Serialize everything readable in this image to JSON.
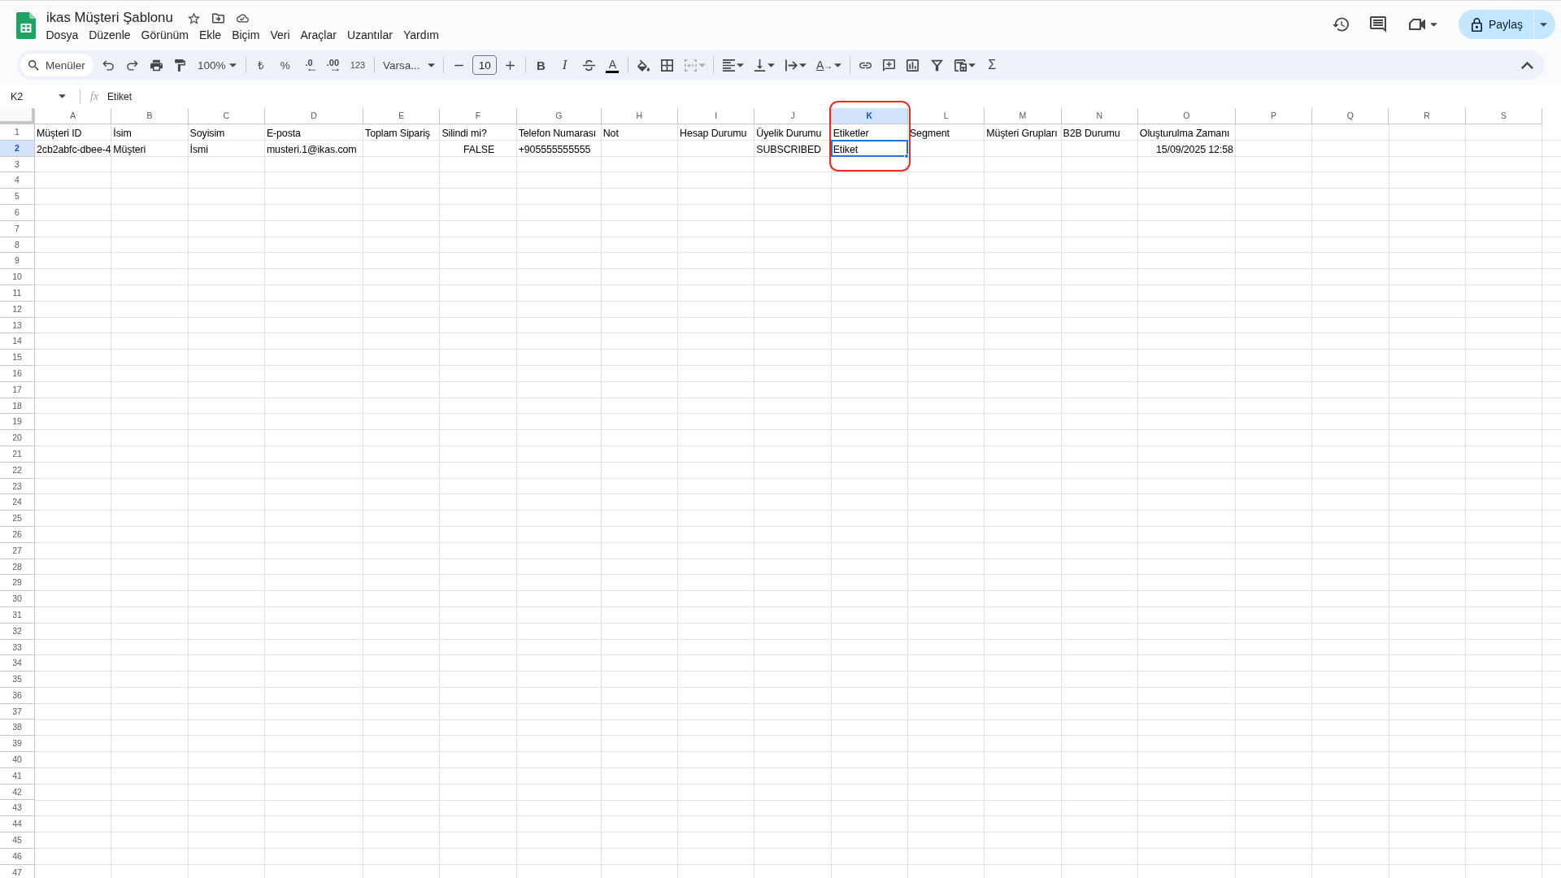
{
  "document": {
    "title": "ikas Müşteri Şablonu"
  },
  "menu": [
    "Dosya",
    "Düzenle",
    "Görünüm",
    "Ekle",
    "Biçim",
    "Veri",
    "Araçlar",
    "Uzantılar",
    "Yardım"
  ],
  "share_button": {
    "label": "Paylaş"
  },
  "toolbar": {
    "search": {
      "placeholder": "Menüler"
    },
    "zoom": "100%",
    "currency": "₺",
    "percent": "%",
    "decrease_decimals": ".0",
    "increase_decimals": ".00",
    "number_format": "123",
    "font": "Varsa...",
    "font_size": "10",
    "bold": "B",
    "italic": "I",
    "text_color": "A",
    "text_rotation": "A",
    "functions": "Σ",
    "merge_cells": {
      "disabled": true
    }
  },
  "formula_bar": {
    "cell": "K2",
    "label": "fx",
    "value": "Etiket"
  },
  "sheet": {
    "columns": [
      {
        "letter": "A",
        "selected": false,
        "highlighted": false
      },
      {
        "letter": "B",
        "selected": false,
        "highlighted": false
      },
      {
        "letter": "C",
        "selected": false,
        "highlighted": false
      },
      {
        "letter": "D",
        "selected": false,
        "highlighted": false
      },
      {
        "letter": "E",
        "selected": false,
        "highlighted": false
      },
      {
        "letter": "F",
        "selected": false,
        "highlighted": false
      },
      {
        "letter": "G",
        "selected": false,
        "highlighted": false
      },
      {
        "letter": "H",
        "selected": false,
        "highlighted": false
      },
      {
        "letter": "I",
        "selected": false,
        "highlighted": false
      },
      {
        "letter": "J",
        "selected": false,
        "highlighted": false
      },
      {
        "letter": "K",
        "selected": true,
        "highlighted": true
      },
      {
        "letter": "L",
        "selected": false,
        "highlighted": false
      },
      {
        "letter": "M",
        "selected": false,
        "highlighted": false
      },
      {
        "letter": "N",
        "selected": false,
        "highlighted": false
      },
      {
        "letter": "O",
        "selected": false,
        "highlighted": false
      },
      {
        "letter": "P",
        "selected": false,
        "highlighted": false
      },
      {
        "letter": "Q",
        "selected": false,
        "highlighted": false
      },
      {
        "letter": "R",
        "selected": false,
        "highlighted": false
      },
      {
        "letter": "S",
        "selected": false,
        "highlighted": false
      }
    ],
    "rows": [
      {
        "number": "1",
        "selected": false,
        "cells": [
          {
            "kind": "text",
            "value": "Müşteri ID"
          },
          {
            "kind": "text",
            "value": "İsim"
          },
          {
            "kind": "text",
            "value": "Soyisim"
          },
          {
            "kind": "text",
            "value": "E-posta"
          },
          {
            "kind": "text",
            "value": "Toplam Sipariş"
          },
          {
            "kind": "text",
            "value": "Silindi mi?"
          },
          {
            "kind": "text",
            "value": "Telefon Numarası"
          },
          {
            "kind": "text",
            "value": "Not"
          },
          {
            "kind": "text",
            "value": "Hesap Durumu"
          },
          {
            "kind": "text",
            "value": "Üyelik Durumu"
          },
          {
            "kind": "text",
            "value": "Etiketler"
          },
          {
            "kind": "text",
            "value": "Segment"
          },
          {
            "kind": "text",
            "value": "Müşteri Grupları"
          },
          {
            "kind": "text",
            "value": "B2B Durumu"
          },
          {
            "kind": "text",
            "value": "Oluşturulma Zamanı"
          }
        ]
      },
      {
        "number": "2",
        "selected": true,
        "cells": [
          {
            "kind": "text",
            "value": "2cb2abfc-dbee-4"
          },
          {
            "kind": "text",
            "value": "Müşteri"
          },
          {
            "kind": "text",
            "value": "İsmi"
          },
          {
            "kind": "text",
            "value": "musteri.1@ikas.com"
          },
          {
            "kind": "blank"
          },
          {
            "kind": "boolean",
            "value": "FALSE"
          },
          {
            "kind": "text",
            "value": "+905555555555"
          },
          {
            "kind": "blank"
          },
          {
            "kind": "blank"
          },
          {
            "kind": "text",
            "value": "SUBSCRIBED"
          },
          {
            "kind": "text",
            "value": "Etiket"
          },
          {
            "kind": "blank"
          },
          {
            "kind": "blank"
          },
          {
            "kind": "blank"
          },
          {
            "kind": "date",
            "value": "15/09/2025 12:58"
          }
        ]
      },
      {
        "number": "3",
        "selected": false
      },
      {
        "number": "4",
        "selected": false
      },
      {
        "number": "5",
        "selected": false
      },
      {
        "number": "6",
        "selected": false
      },
      {
        "number": "7",
        "selected": false
      },
      {
        "number": "8",
        "selected": false
      },
      {
        "number": "9",
        "selected": false
      },
      {
        "number": "10",
        "selected": false
      },
      {
        "number": "11",
        "selected": false
      },
      {
        "number": "12",
        "selected": false
      },
      {
        "number": "13",
        "selected": false
      },
      {
        "number": "14",
        "selected": false
      },
      {
        "number": "15",
        "selected": false
      },
      {
        "number": "16",
        "selected": false
      },
      {
        "number": "17",
        "selected": false
      },
      {
        "number": "18",
        "selected": false
      },
      {
        "number": "19",
        "selected": false
      },
      {
        "number": "20",
        "selected": false
      },
      {
        "number": "21",
        "selected": false
      },
      {
        "number": "22",
        "selected": false
      },
      {
        "number": "23",
        "selected": false
      },
      {
        "number": "24",
        "selected": false
      },
      {
        "number": "25",
        "selected": false
      },
      {
        "number": "26",
        "selected": false
      },
      {
        "number": "27",
        "selected": false
      },
      {
        "number": "28",
        "selected": false
      },
      {
        "number": "29",
        "selected": false
      },
      {
        "number": "30",
        "selected": false
      },
      {
        "number": "31",
        "selected": false
      },
      {
        "number": "32",
        "selected": false
      },
      {
        "number": "33",
        "selected": false
      },
      {
        "number": "34",
        "selected": false
      },
      {
        "number": "35",
        "selected": false
      },
      {
        "number": "36",
        "selected": false
      },
      {
        "number": "37",
        "selected": false
      },
      {
        "number": "38",
        "selected": false
      },
      {
        "number": "39",
        "selected": false
      },
      {
        "number": "40",
        "selected": false
      },
      {
        "number": "41",
        "selected": false
      },
      {
        "number": "42",
        "selected": false
      },
      {
        "number": "43",
        "selected": false
      },
      {
        "number": "44",
        "selected": false
      },
      {
        "number": "45",
        "selected": false
      },
      {
        "number": "46",
        "selected": false
      },
      {
        "number": "47",
        "selected": false
      }
    ]
  }
}
